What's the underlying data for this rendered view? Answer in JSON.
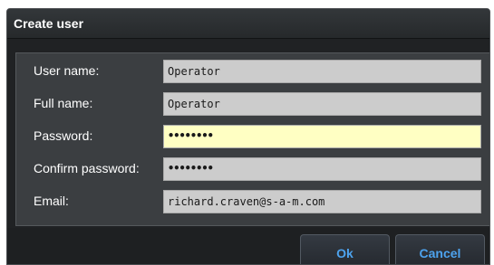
{
  "dialog": {
    "title": "Create user"
  },
  "form": {
    "fields": [
      {
        "label": "User name:",
        "value": "Operator"
      },
      {
        "label": "Full name:",
        "value": "Operator"
      },
      {
        "label": "Password:",
        "value": "••••••••"
      },
      {
        "label": "Confirm password:",
        "value": "••••••••"
      },
      {
        "label": "Email:",
        "value": "richard.craven@s-a-m.com"
      }
    ],
    "focused_field": "Password:",
    "focus_color": "#ffffc3"
  },
  "buttons": {
    "ok_label": "Ok",
    "cancel_label": "Cancel",
    "button_text_color": "#4da3ee"
  }
}
